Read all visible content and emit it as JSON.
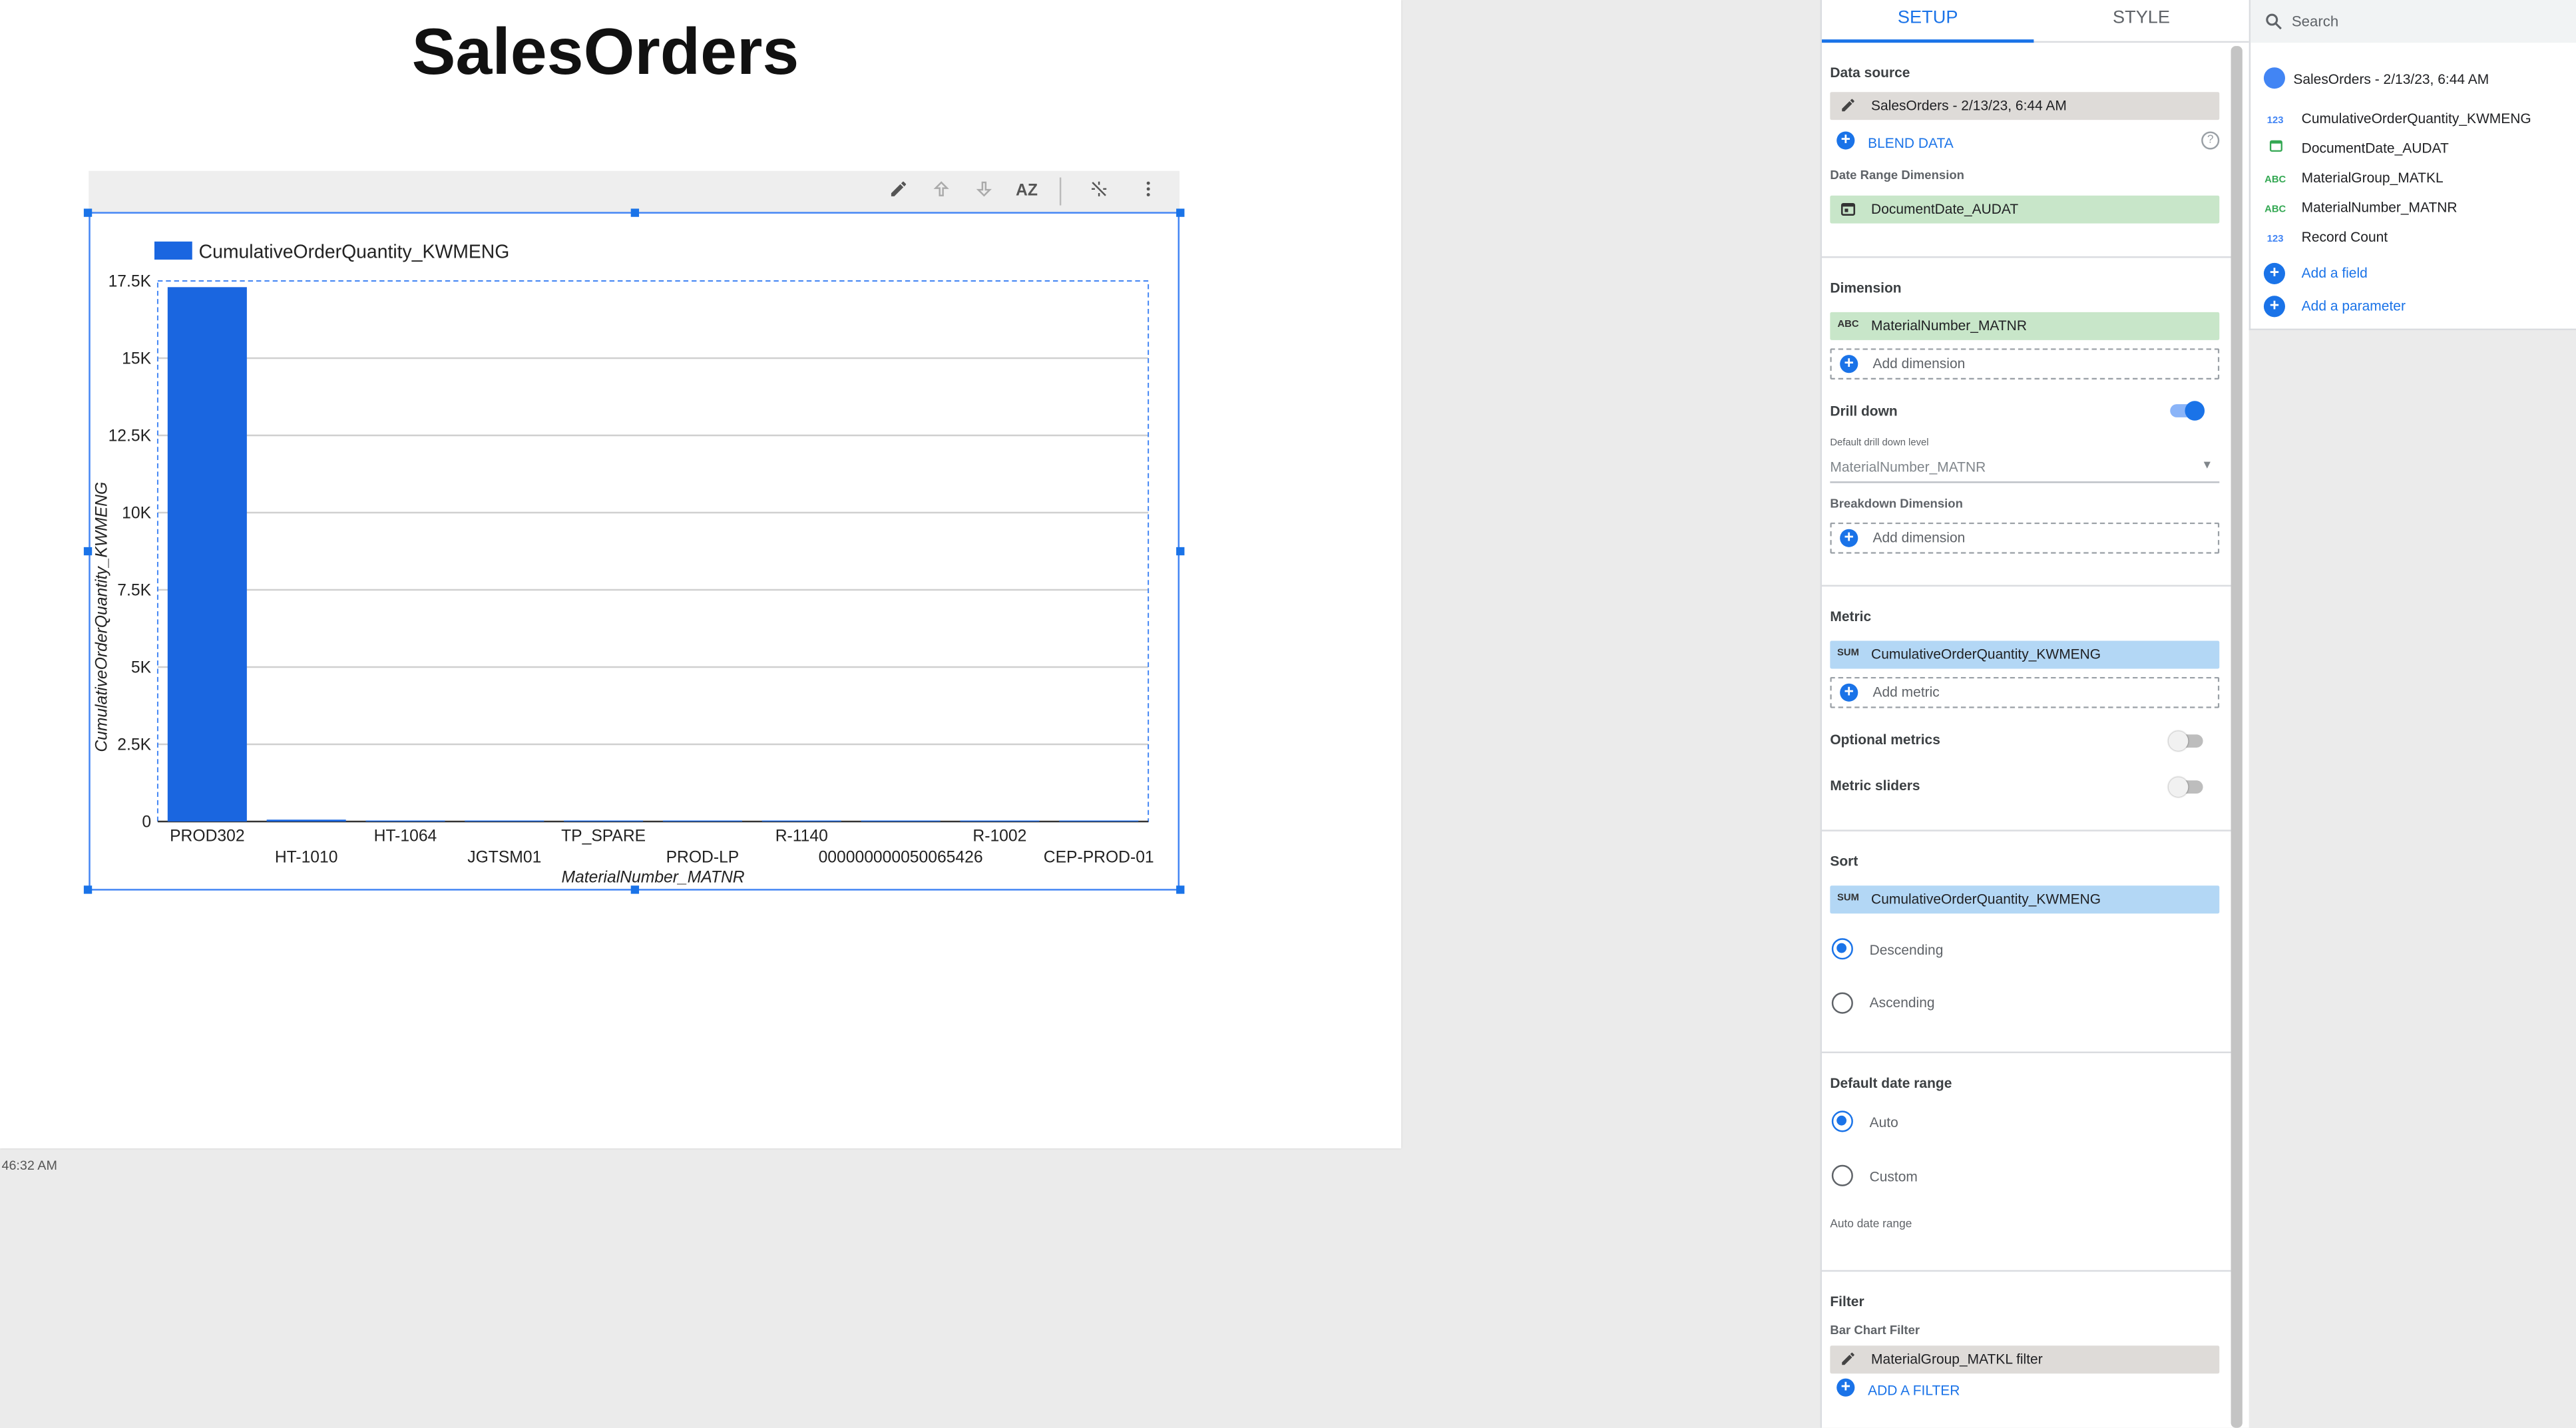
{
  "report": {
    "title": "SalesOrders",
    "timestamp": "46:32 AM"
  },
  "toolbar": {
    "edit_icon": "pencil-icon",
    "up_icon": "arrow-up-icon",
    "down_icon": "arrow-down-icon",
    "sort_icon": "sort-az-icon",
    "sort_label": "AZ",
    "pin_icon": "no-magic-icon",
    "more_icon": "more-vert-icon"
  },
  "chart_data": {
    "type": "bar",
    "legend": "CumulativeOrderQuantity_KWMENG",
    "legend_position": "top-left",
    "categories": [
      "PROD302",
      "HT-1010",
      "HT-1064",
      "JGTSM01",
      "TP_SPARE",
      "PROD-LP",
      "R-1140",
      "000000000050065426",
      "R-1002",
      "CEP-PROD-01"
    ],
    "values": [
      17300,
      60,
      2,
      1,
      1,
      1,
      1,
      1,
      1,
      1
    ],
    "ylim": [
      0,
      17500
    ],
    "yticks": [
      "0",
      "2.5K",
      "5K",
      "7.5K",
      "10K",
      "12.5K",
      "15K",
      "17.5K"
    ],
    "xlabel": "MaterialNumber_MATNR",
    "ylabel": "CumulativeOrderQuantity_KWMENG",
    "bar_color": "#1a66e0",
    "grid": true
  },
  "setup": {
    "tab_setup": "SETUP",
    "tab_style": "STYLE",
    "data_source_title": "Data source",
    "data_source_value": "SalesOrders - 2/13/23, 6:44 AM",
    "blend_data": "BLEND DATA",
    "date_range_title": "Date Range Dimension",
    "date_range_value": "DocumentDate_AUDAT",
    "dimension_title": "Dimension",
    "dimension_value": "MaterialNumber_MATNR",
    "add_dimension": "Add dimension",
    "drill_down": "Drill down",
    "drill_level_label": "Default drill down level",
    "drill_level_value": "MaterialNumber_MATNR",
    "breakdown_title": "Breakdown Dimension",
    "add_breakdown": "Add dimension",
    "metric_title": "Metric",
    "metric_value": "CumulativeOrderQuantity_KWMENG",
    "add_metric": "Add metric",
    "optional_metrics": "Optional metrics",
    "metric_sliders": "Metric sliders",
    "sort_title": "Sort",
    "sort_value": "CumulativeOrderQuantity_KWMENG",
    "descending": "Descending",
    "ascending": "Ascending",
    "date_range_default_title": "Default date range",
    "auto": "Auto",
    "custom": "Custom",
    "auto_date_range": "Auto date range",
    "filter_title": "Filter",
    "bar_chart_filter": "Bar Chart Filter",
    "filter_value": "MaterialGroup_MATKL filter",
    "add_filter": "ADD A FILTER",
    "type_abc": "ABC",
    "type_sum": "SUM",
    "help_mark": "?"
  },
  "fields_panel": {
    "search_placeholder": "Search",
    "data_source": "SalesOrders - 2/13/23, 6:44 AM",
    "fields": [
      {
        "type": "123",
        "name": "CumulativeOrderQuantity_KWMENG"
      },
      {
        "type": "date",
        "name": "DocumentDate_AUDAT"
      },
      {
        "type": "ABC",
        "name": "MaterialGroup_MATKL"
      },
      {
        "type": "ABC",
        "name": "MaterialNumber_MATNR"
      },
      {
        "type": "123",
        "name": "Record Count"
      }
    ],
    "add_field": "Add a field",
    "add_parameter": "Add a parameter"
  }
}
